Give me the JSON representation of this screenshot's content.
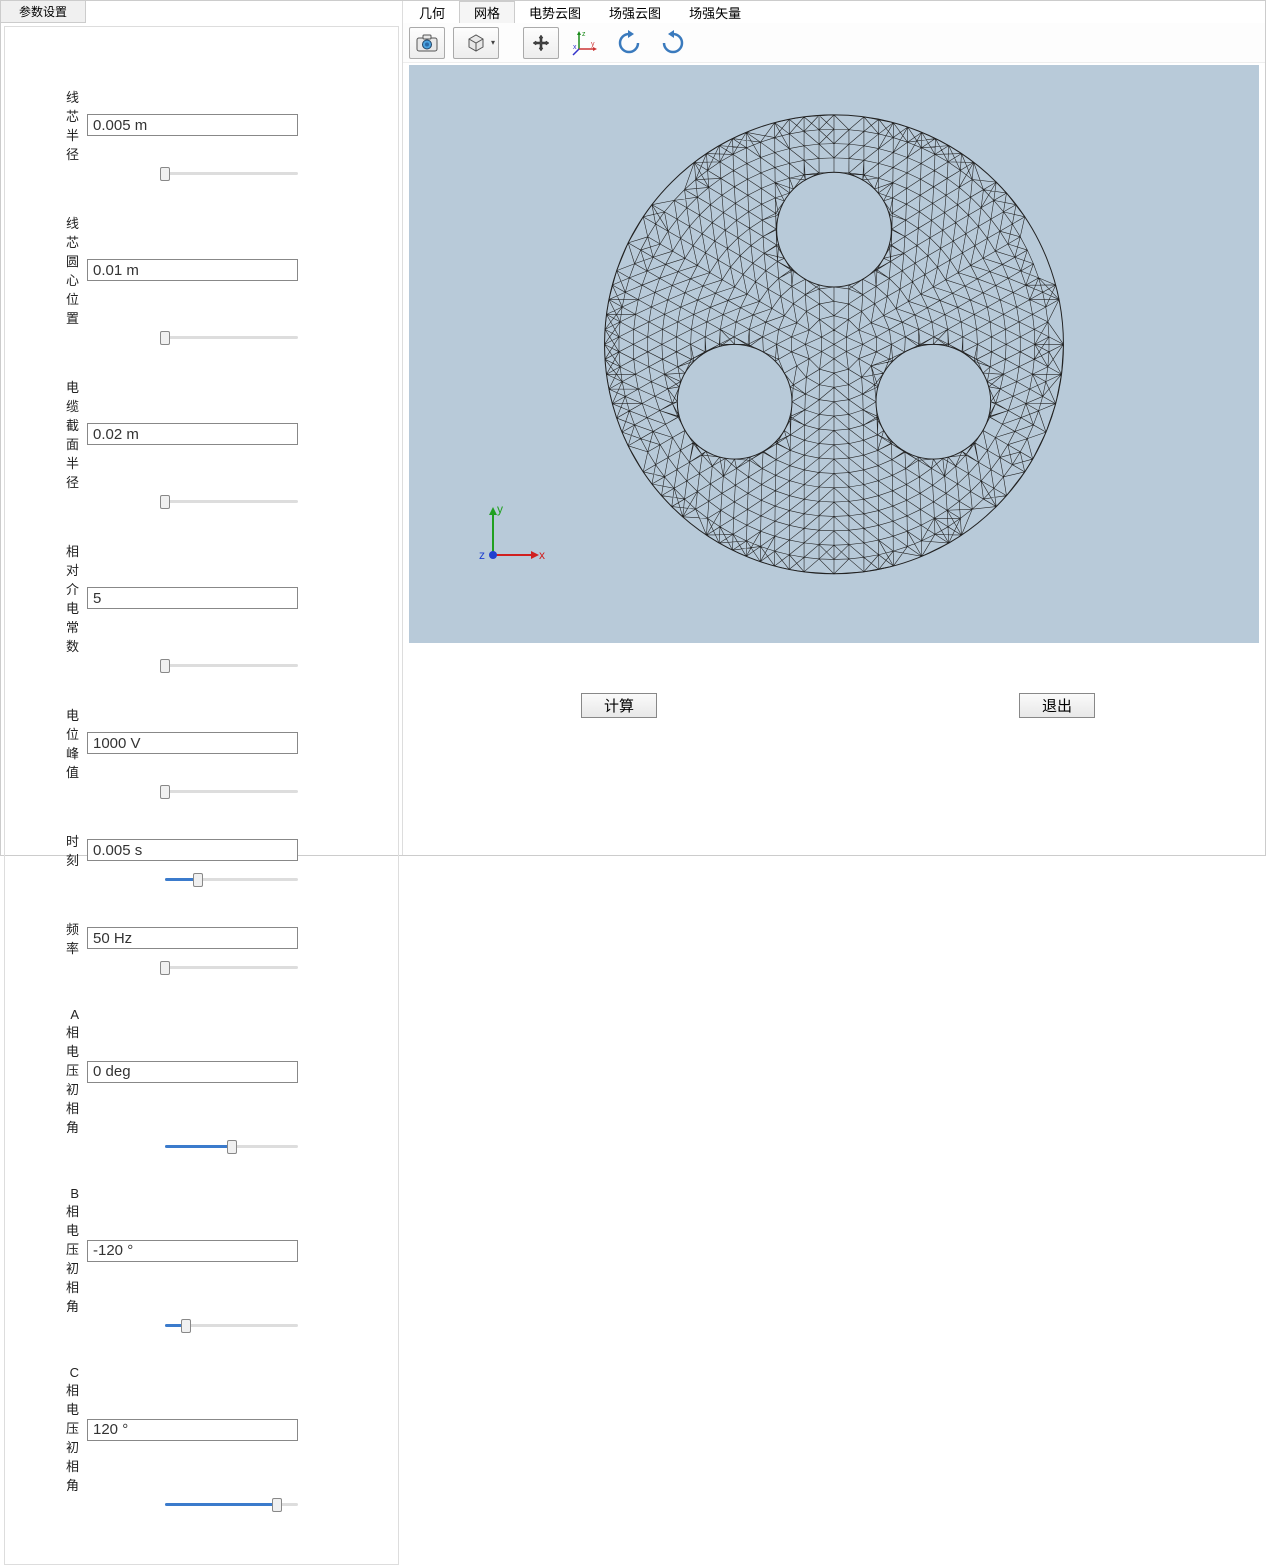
{
  "sidebar": {
    "tab_label": "参数设置",
    "params": [
      {
        "label": "线芯半径",
        "value": "0.005 m",
        "pos": 0
      },
      {
        "label": "线芯圆心位置",
        "value": "0.01 m",
        "pos": 0
      },
      {
        "label": "电缆截面半径",
        "value": "0.02 m",
        "pos": 0
      },
      {
        "label": "相对介电常数",
        "value": "5",
        "pos": 0
      },
      {
        "label": "电位峰值",
        "value": "1000 V",
        "pos": 0
      },
      {
        "label": "时刻",
        "value": "0.005 s",
        "pos": 25
      },
      {
        "label": "频率",
        "value": "50 Hz",
        "pos": 0
      },
      {
        "label": "A相电压初相角",
        "value": "0 deg",
        "pos": 50
      },
      {
        "label": "B相电压初相角",
        "value": "-120 °",
        "pos": 16
      },
      {
        "label": "C相电压初相角",
        "value": "120 °",
        "pos": 84
      }
    ]
  },
  "tabs": {
    "items": [
      {
        "label": "几何",
        "active": false
      },
      {
        "label": "网格",
        "active": true
      },
      {
        "label": "电势云图",
        "active": false
      },
      {
        "label": "场强云图",
        "active": false
      },
      {
        "label": "场强矢量",
        "active": false
      }
    ]
  },
  "toolbar": {
    "camera": "camera-icon",
    "cube": "cube-icon",
    "pan": "pan-icon",
    "axes": "axes-icon",
    "rotate_ccw": "rotate-ccw-icon",
    "rotate_cw": "rotate-cw-icon"
  },
  "axes_labels": {
    "x": "x",
    "y": "y",
    "z": "z"
  },
  "buttons": {
    "compute": "计算",
    "exit": "退出"
  },
  "mesh": {
    "outer_radius": 0.02,
    "core_radius": 0.005,
    "core_center_distance": 0.01,
    "core_count": 3
  }
}
